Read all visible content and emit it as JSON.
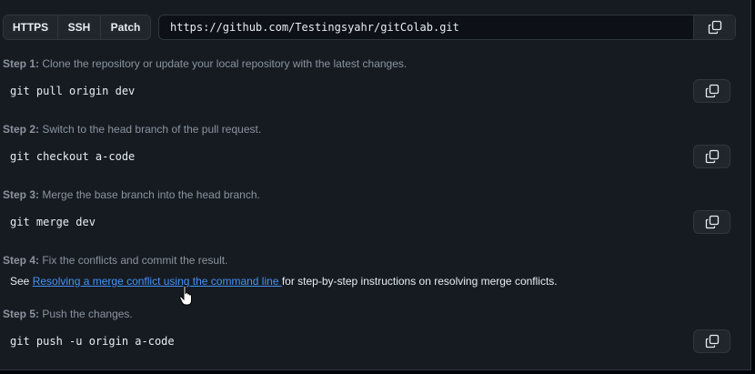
{
  "protocol_tabs": [
    "HTTPS",
    "SSH",
    "Patch"
  ],
  "clone_url": "https://github.com/Testingsyahr/gitColab.git",
  "steps": [
    {
      "label": "Step 1:",
      "text": " Clone the repository or update your local repository with the latest changes.",
      "command": "git pull origin dev"
    },
    {
      "label": "Step 2:",
      "text": " Switch to the head branch of the pull request.",
      "command": "git checkout a-code"
    },
    {
      "label": "Step 3:",
      "text": " Merge the base branch into the head branch.",
      "command": "git merge dev"
    },
    {
      "label": "Step 4:",
      "text": " Fix the conflicts and commit the result."
    },
    {
      "label": "Step 5:",
      "text": " Push the changes.",
      "command": "git push -u origin a-code"
    }
  ],
  "step4_note": {
    "prefix": "See ",
    "link": "Resolving a merge conflict using the command line ",
    "suffix": "for step-by-step instructions on resolving merge conflicts."
  },
  "icons": {
    "copy": "copy-icon",
    "cursor": "hand-pointer-icon"
  },
  "colors": {
    "background": "#161b22",
    "link": "#4493f8",
    "muted": "#8b949e",
    "border": "#30363d"
  }
}
